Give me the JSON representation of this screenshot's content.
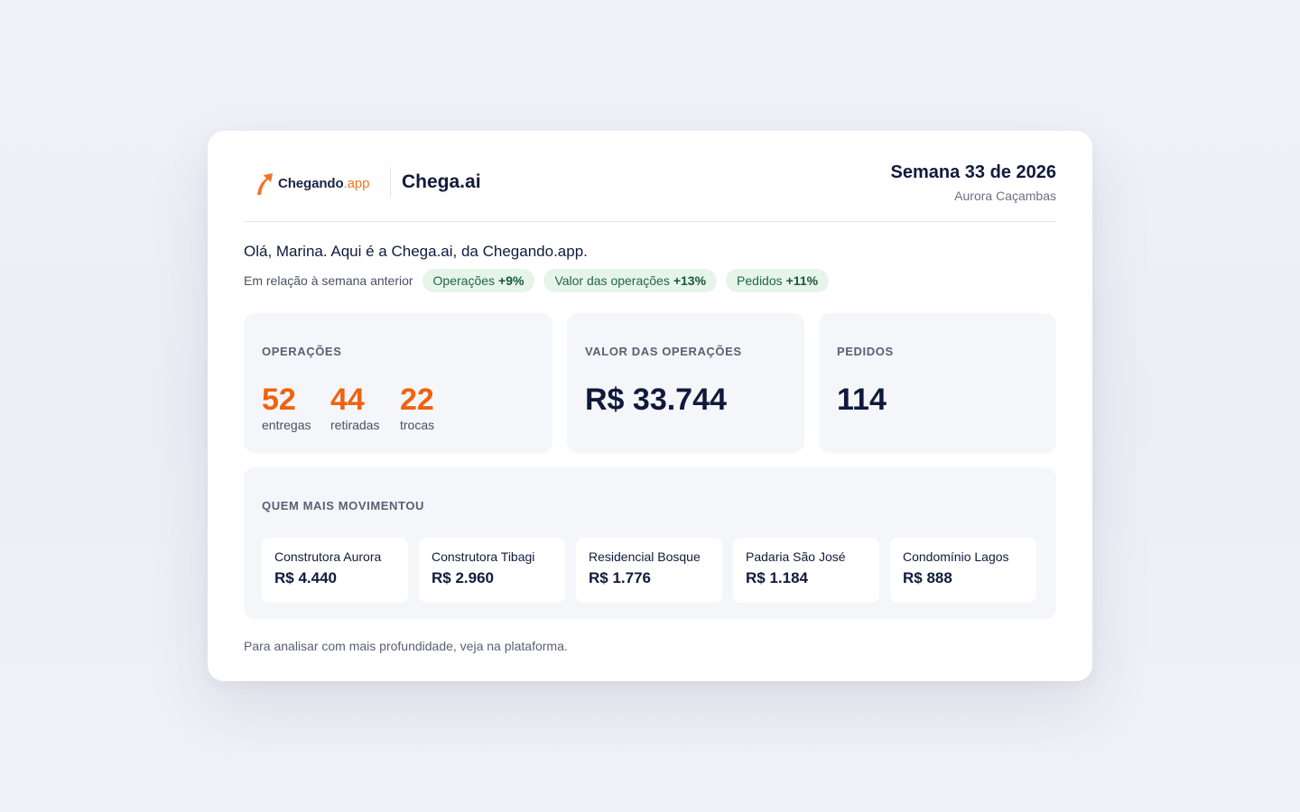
{
  "brand": {
    "logo_name": "Chegando",
    "logo_suffix": ".app",
    "logo_color": "#f27524",
    "product": "Chega.ai"
  },
  "report": {
    "week": "Semana 33 de 2026",
    "company": "Aurora Caçambas"
  },
  "greeting": "Olá, Marina. Aqui é a Chega.ai, da Chegando.app.",
  "comparison": {
    "label": "Em relação à semana anterior",
    "pills": [
      {
        "label": "Operações",
        "delta": "+9%"
      },
      {
        "label": "Valor das operações",
        "delta": "+13%"
      },
      {
        "label": "Pedidos",
        "delta": "+11%"
      }
    ]
  },
  "operations": {
    "title": "OPERAÇÕES",
    "stats": [
      {
        "value": "52",
        "label": "entregas"
      },
      {
        "value": "44",
        "label": "retiradas"
      },
      {
        "value": "22",
        "label": "trocas"
      }
    ]
  },
  "value": {
    "title": "VALOR DAS OPERAÇÕES",
    "amount": "R$ 33.744"
  },
  "orders": {
    "title": "PEDIDOS",
    "count": "114"
  },
  "top_clients": {
    "title": "QUEM MAIS MOVIMENTOU",
    "items": [
      {
        "name": "Construtora Aurora",
        "value": "R$ 4.440"
      },
      {
        "name": "Construtora Tibagi",
        "value": "R$ 2.960"
      },
      {
        "name": "Residencial Bosque",
        "value": "R$ 1.776"
      },
      {
        "name": "Padaria São José",
        "value": "R$ 1.184"
      },
      {
        "name": "Condomínio Lagos",
        "value": "R$ 888"
      }
    ]
  },
  "footer": "Para analisar com mais profundidade, veja na plataforma.",
  "colors": {
    "accent": "#f0620f",
    "positive_bg": "#e6f4ea",
    "positive_text": "#1f6a3e",
    "navy": "#0f1a3a"
  }
}
